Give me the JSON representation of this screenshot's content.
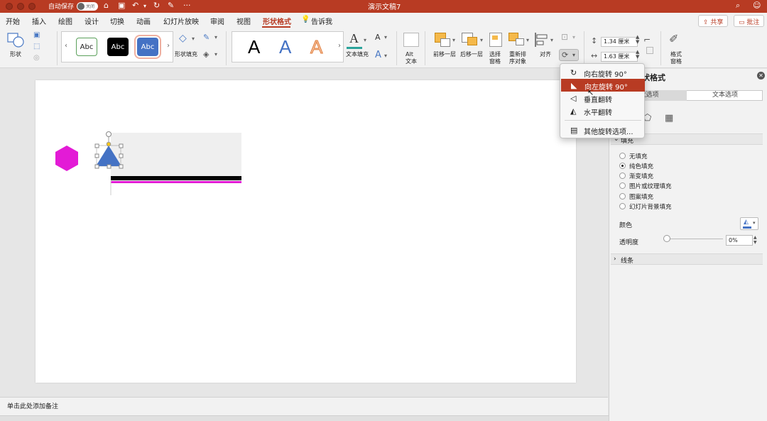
{
  "titlebar": {
    "autosave_label": "自动保存",
    "autosave_state": "关闭",
    "doc_title": "演示文稿7",
    "more": "···"
  },
  "tabs": [
    {
      "label": "开始"
    },
    {
      "label": "插入"
    },
    {
      "label": "绘图"
    },
    {
      "label": "设计"
    },
    {
      "label": "切换"
    },
    {
      "label": "动画"
    },
    {
      "label": "幻灯片放映"
    },
    {
      "label": "审阅"
    },
    {
      "label": "视图"
    },
    {
      "label": "形状格式"
    },
    {
      "label": "告诉我"
    }
  ],
  "header_buttons": {
    "share": "共享",
    "comment": "批注"
  },
  "ribbon": {
    "shapes_label": "形状",
    "style_sample": "Abc",
    "shape_fill_label": "形状填充",
    "wordart_glyph": "A",
    "text_fill_label": "文本填充",
    "alt_text_line1": "Alt",
    "alt_text_line2": "文本",
    "bring_forward": "前移一层",
    "send_backward": "后移一层",
    "selection_pane_line1": "选择",
    "selection_pane_line2": "窗格",
    "reorder_line1": "重新排",
    "reorder_line2": "序对象",
    "align": "对齐",
    "height_value": "1.34 厘米",
    "width_value": "1.63 厘米",
    "format_pane_line1": "格式",
    "format_pane_line2": "窗格"
  },
  "rotate_menu": {
    "items": [
      {
        "label": "向右旋转 90°",
        "icon": "↻"
      },
      {
        "label": "向左旋转 90°",
        "icon": "◣"
      },
      {
        "label": "垂直翻转",
        "icon": "◁"
      },
      {
        "label": "水平翻转",
        "icon": "◭"
      },
      {
        "label": "其他旋转选项...",
        "icon": "▤"
      }
    ]
  },
  "pane": {
    "title": "状格式",
    "tab_shape": "状选项",
    "tab_text": "文本选项",
    "fill_section": "填充",
    "fill_options": [
      {
        "label": "无填充"
      },
      {
        "label": "纯色填充"
      },
      {
        "label": "渐变填充"
      },
      {
        "label": "图片或纹理填充"
      },
      {
        "label": "图案填充"
      },
      {
        "label": "幻灯片背景填充"
      }
    ],
    "color_label": "颜色",
    "transparency_label": "透明度",
    "transparency_value": "0%",
    "transparency_level": 0,
    "line_section": "线条"
  },
  "notes_placeholder": "单击此处添加备注",
  "colors": {
    "accent": "#b83b23",
    "hexagon": "#e31bd6",
    "triangle": "#4472c4",
    "magenta_bar": "#e31bd6"
  }
}
